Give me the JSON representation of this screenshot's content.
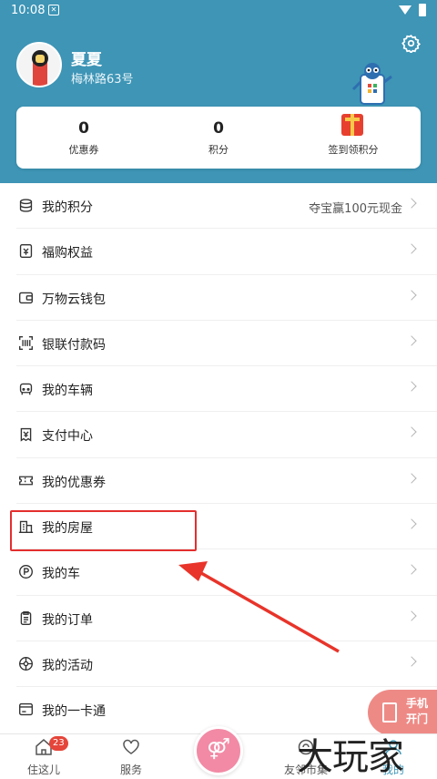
{
  "status_bar": {
    "time": "10:08"
  },
  "profile": {
    "name": "夏夏",
    "address": "梅林路63号"
  },
  "stats": [
    {
      "value": "0",
      "label": "优惠券"
    },
    {
      "value": "0",
      "label": "积分"
    },
    {
      "label": "签到领积分"
    }
  ],
  "menu": [
    {
      "label": "我的积分",
      "right_text": "夺宝赢100元现金",
      "icon": "coins-icon"
    },
    {
      "label": "福购权益",
      "icon": "benefit-icon"
    },
    {
      "label": "万物云钱包",
      "icon": "wallet-icon"
    },
    {
      "label": "银联付款码",
      "icon": "scan-icon"
    },
    {
      "label": "我的车辆",
      "icon": "car-icon"
    },
    {
      "label": "支付中心",
      "icon": "payment-icon"
    },
    {
      "label": "我的优惠券",
      "icon": "ticket-icon"
    },
    {
      "label": "我的房屋",
      "icon": "building-icon"
    },
    {
      "label": "我的车",
      "icon": "parking-icon"
    },
    {
      "label": "我的订单",
      "icon": "order-icon"
    },
    {
      "label": "我的活动",
      "icon": "activity-icon"
    },
    {
      "label": "我的一卡通",
      "icon": "card-icon"
    }
  ],
  "door_button": {
    "line1": "手机",
    "line2": "开门"
  },
  "tabs": [
    {
      "label": "住这儿",
      "badge": "23"
    },
    {
      "label": "服务"
    },
    {
      "label": ""
    },
    {
      "label": "友邻市集"
    },
    {
      "label": "我的"
    }
  ],
  "watermark": "大玩家",
  "colors": {
    "header": "#3e95b6",
    "highlight": "#e42e2e",
    "door_button": "#ee8a86"
  }
}
